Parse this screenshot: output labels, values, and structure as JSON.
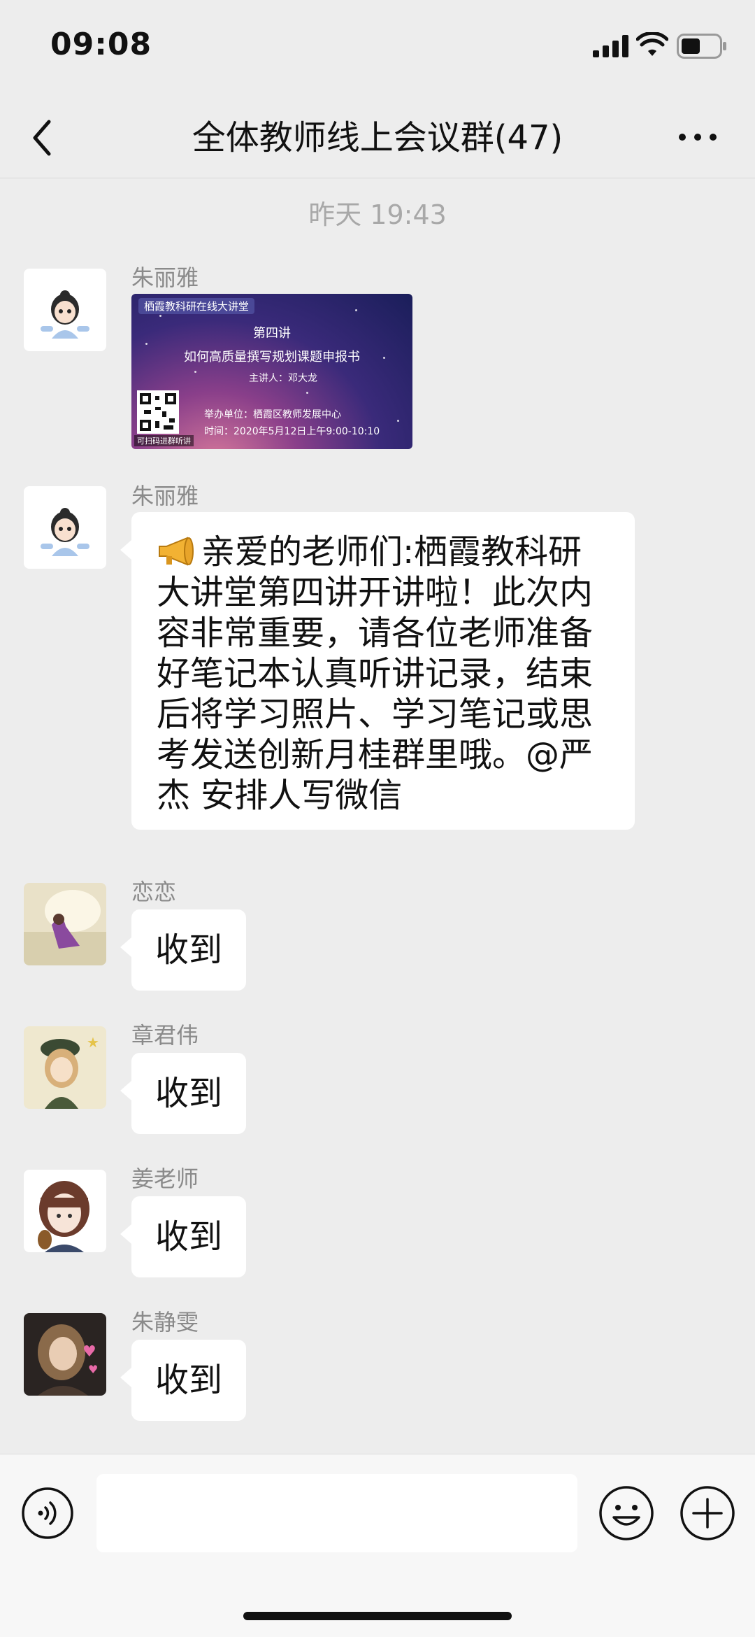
{
  "status_bar": {
    "time": "09:08"
  },
  "nav": {
    "title": "全体教师线上会议群(47)"
  },
  "timestamp": "昨天 19:43",
  "messages": [
    {
      "sender": "朱丽雅",
      "type": "image",
      "poster": {
        "header": "栖霞教科研在线大讲堂",
        "lecture": "第四讲",
        "title": "如何高质量撰写规划课题申报书",
        "speaker": "主讲人：邓大龙",
        "host": "举办单位：栖霞区教师发展中心",
        "time": "时间：2020年5月12日上午9:00-10:10",
        "qr_caption": "可扫码进群听讲"
      }
    },
    {
      "sender": "朱丽雅",
      "type": "text",
      "icon": "megaphone-icon",
      "text": "亲爱的老师们:栖霞教科研大讲堂第四讲开讲啦！此次内容非常重要，请各位老师准备好笔记本认真听讲记录，结束后将学习照片、学习笔记或思考发送创新月桂群里哦。@严杰 安排人写微信"
    },
    {
      "sender": "恋恋",
      "type": "text",
      "text": "收到"
    },
    {
      "sender": "章君伟",
      "type": "text",
      "text": "收到"
    },
    {
      "sender": "姜老师",
      "type": "text",
      "text": "收到"
    },
    {
      "sender": "朱静雯",
      "type": "text",
      "text": "收到"
    }
  ],
  "input_bar": {
    "value": "",
    "icons": [
      "voice-icon",
      "emoji-icon",
      "plus-icon"
    ]
  },
  "colors": {
    "background": "#ededed",
    "bubble": "#ffffff",
    "sender_name": "#8a8a8a",
    "timestamp": "#a8a8a8"
  }
}
